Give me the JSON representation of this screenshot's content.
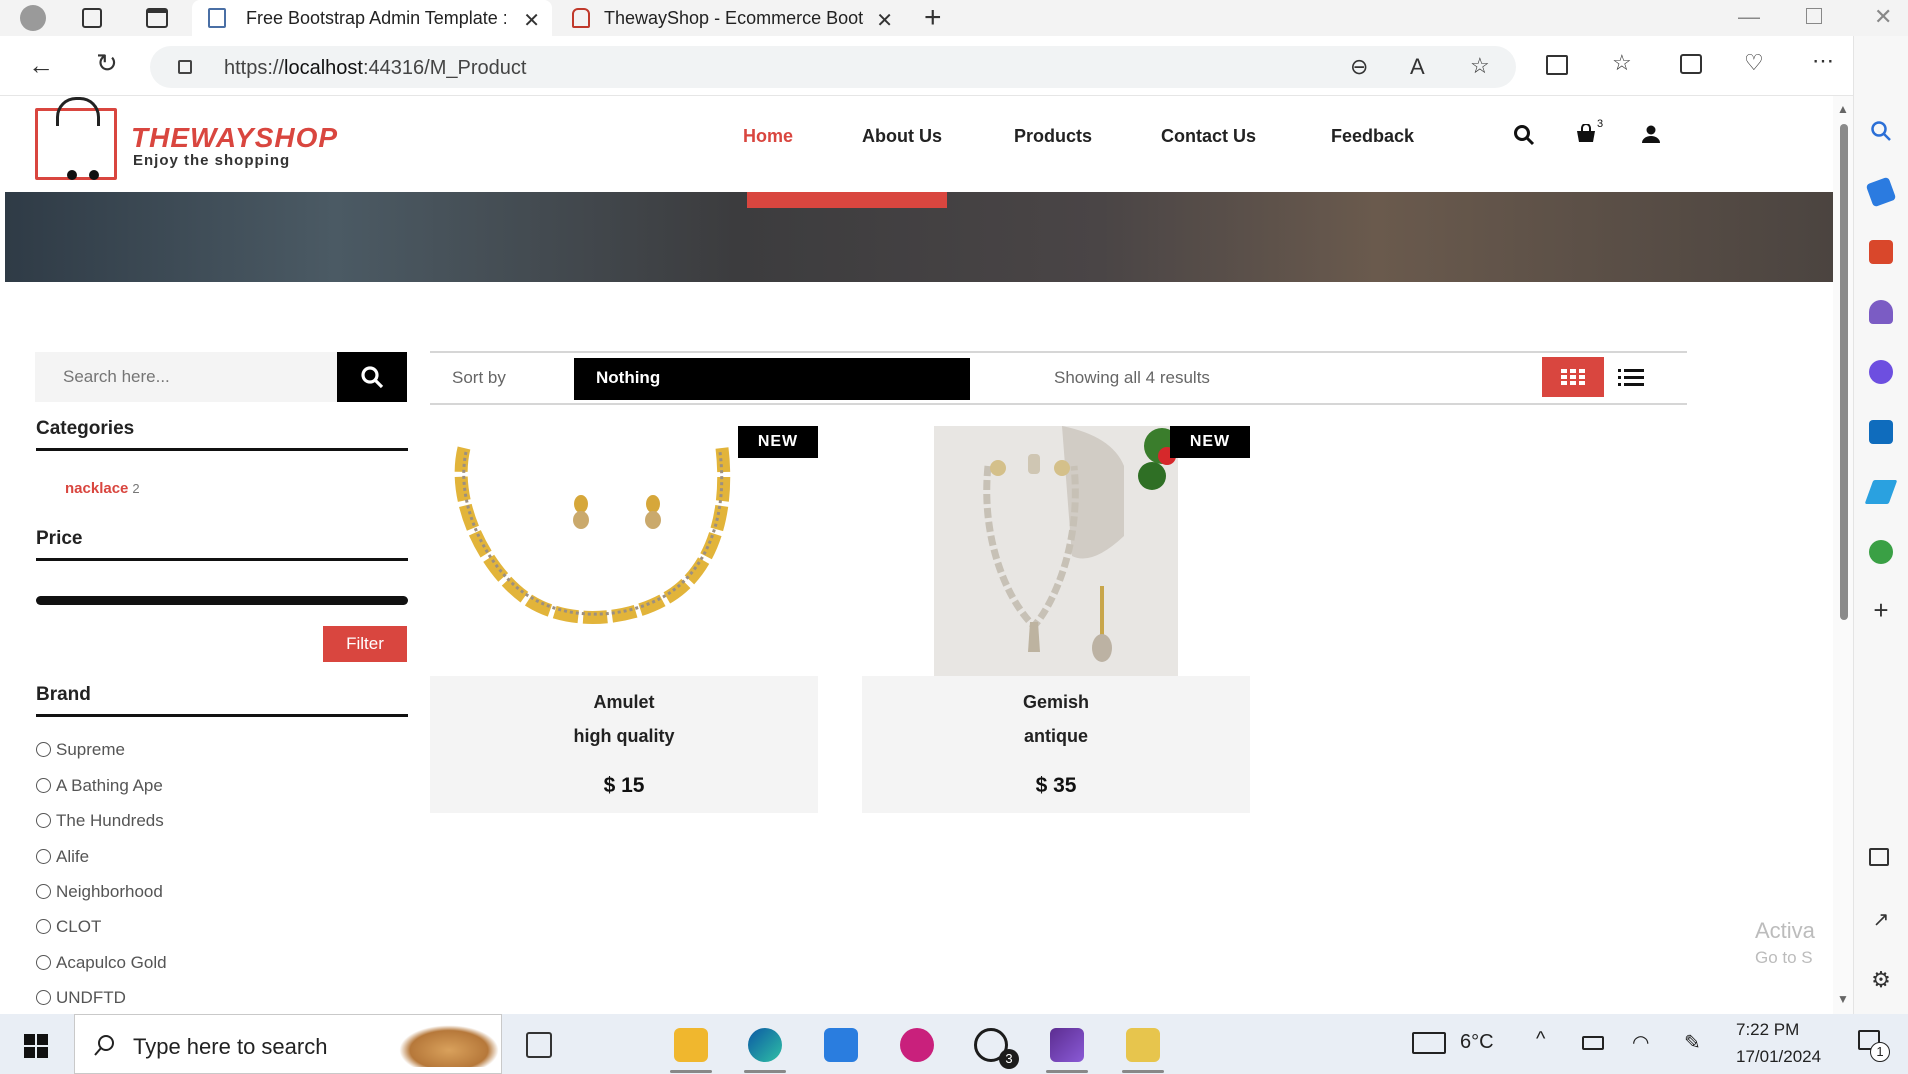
{
  "browser": {
    "tabs": [
      {
        "label": "Free Bootstrap Admin Template :",
        "active": true
      },
      {
        "label": "ThewayShop - Ecommerce Boots",
        "active": false
      }
    ],
    "url_prefix": "https://",
    "url_host": "localhost",
    "url_rest": ":44316/M_Product"
  },
  "site": {
    "logo_title": "THEWAYSHOP",
    "logo_tagline": "Enjoy the shopping",
    "nav": [
      "Home",
      "About Us",
      "Products",
      "Contact Us",
      "Feedback"
    ],
    "active_nav": "Home",
    "cart_count": "3"
  },
  "sidebar": {
    "search_placeholder": "Search here...",
    "categories_heading": "Categories",
    "category": {
      "name": "nacklace",
      "count": "2"
    },
    "price_heading": "Price",
    "filter_label": "Filter",
    "brand_heading": "Brand",
    "brands": [
      "Supreme",
      "A Bathing Ape",
      "The Hundreds",
      "Alife",
      "Neighborhood",
      "CLOT",
      "Acapulco Gold",
      "UNDFTD"
    ]
  },
  "toolbar": {
    "sort_label": "Sort by",
    "sort_value": "Nothing",
    "results_text": "Showing all 4 results"
  },
  "products": [
    {
      "badge": "NEW",
      "name": "Amulet",
      "desc": "high quality",
      "price": "$ 15"
    },
    {
      "badge": "NEW",
      "name": "Gemish",
      "desc": "antique",
      "price": "$ 35"
    }
  ],
  "watermark": {
    "line1": "Activa",
    "line2": "Go to S"
  },
  "taskbar": {
    "search_text": "Type here to search",
    "weather": "6°C",
    "time": "7:22 PM",
    "date": "17/01/2024",
    "whatsapp_badge": "3",
    "notification_count": "1"
  },
  "colors": {
    "accent": "#d9463f",
    "dark": "#000000"
  }
}
